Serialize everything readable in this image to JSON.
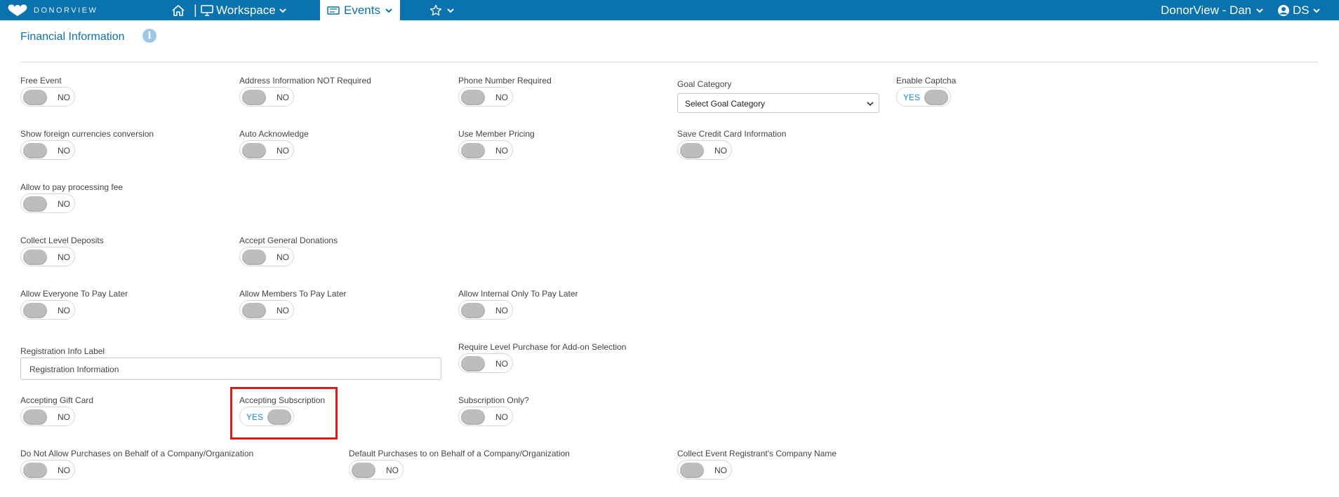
{
  "nav": {
    "logo_text": "DONORVIEW",
    "workspace_label": "Workspace",
    "events_label": "Events",
    "separator": "|",
    "user_label": "DonorView - Dan",
    "account_initials": "DS"
  },
  "section": {
    "title": "Financial Information"
  },
  "fields": {
    "free_event": {
      "label": "Free Event",
      "state": "NO"
    },
    "address_not_required": {
      "label": "Address Information NOT Required",
      "state": "NO"
    },
    "phone_required": {
      "label": "Phone Number Required",
      "state": "NO"
    },
    "goal_category": {
      "label": "Goal Category",
      "value": "Select Goal Category"
    },
    "enable_captcha": {
      "label": "Enable Captcha",
      "state": "YES"
    },
    "foreign_currencies": {
      "label": "Show foreign currencies conversion",
      "state": "NO"
    },
    "auto_acknowledge": {
      "label": "Auto Acknowledge",
      "state": "NO"
    },
    "member_pricing": {
      "label": "Use Member Pricing",
      "state": "NO"
    },
    "save_credit_card": {
      "label": "Save Credit Card Information",
      "state": "NO"
    },
    "processing_fee": {
      "label": "Allow to pay processing fee",
      "state": "NO"
    },
    "level_deposits": {
      "label": "Collect Level Deposits",
      "state": "NO"
    },
    "general_donations": {
      "label": "Accept General Donations",
      "state": "NO"
    },
    "everyone_pay_later": {
      "label": "Allow Everyone To Pay Later",
      "state": "NO"
    },
    "members_pay_later": {
      "label": "Allow Members To Pay Later",
      "state": "NO"
    },
    "internal_pay_later": {
      "label": "Allow Internal Only To Pay Later",
      "state": "NO"
    },
    "registration_info_label": {
      "label": "Registration Info Label",
      "value": "Registration Information"
    },
    "level_purchase_addon": {
      "label": "Require Level Purchase for Add-on Selection",
      "state": "NO"
    },
    "gift_card": {
      "label": "Accepting Gift Card",
      "state": "NO"
    },
    "accepting_subscription": {
      "label": "Accepting Subscription",
      "state": "YES"
    },
    "subscription_only": {
      "label": "Subscription Only?",
      "state": "NO"
    },
    "no_behalf_company": {
      "label": "Do Not Allow Purchases on Behalf of a Company/Organization",
      "state": "NO"
    },
    "default_behalf_company": {
      "label": "Default Purchases to on Behalf of a Company/Organization",
      "state": "NO"
    },
    "registrant_company_name": {
      "label": "Collect Event Registrant's Company Name",
      "state": "NO"
    }
  },
  "colors": {
    "nav_bg": "#0b72b0",
    "accent": "#1a8bd6",
    "highlight": "#e01b1b"
  }
}
